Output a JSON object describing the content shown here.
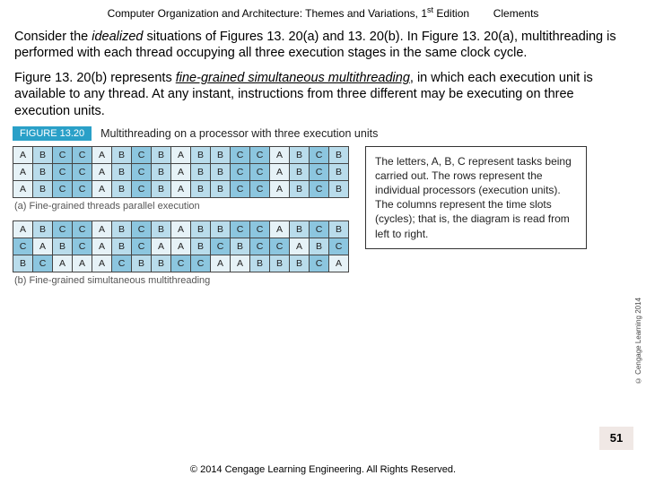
{
  "header": {
    "book": "Computer Organization and Architecture: Themes and Variations, 1",
    "edition_sup": "st",
    "edition_after": " Edition",
    "author": "Clements"
  },
  "para1_a": "Consider the ",
  "para1_b": "idealized",
  "para1_c": " situations of Figures 13. 20(a) and 13. 20(b). In Figure 13. 20(a), multithreading is performed with each thread occupying all three execution stages in the same clock cycle.",
  "para2_a": "Figure 13. 20(b) represents ",
  "para2_b": "fine-grained simultaneous multithreading",
  "para2_c": ", in which each execution unit is available to any thread. At any instant, instructions from three different may be executing on three execution units.",
  "figure": {
    "chip": "FIGURE 13.20",
    "title": "Multithreading on a processor with three execution units",
    "caption_a": "(a) Fine-grained threads parallel execution",
    "caption_b": "(b) Fine-grained simultaneous multithreading",
    "side_note": "The letters, A, B, C represent tasks being carried out. The rows represent the individual processors (execution units). The columns represent the time slots (cycles); that is, the diagram is read from left to right.",
    "table_a": [
      [
        "A",
        "B",
        "C",
        "C",
        "A",
        "B",
        "C",
        "B",
        "A",
        "B",
        "B",
        "C",
        "C",
        "A",
        "B",
        "C",
        "B"
      ],
      [
        "A",
        "B",
        "C",
        "C",
        "A",
        "B",
        "C",
        "B",
        "A",
        "B",
        "B",
        "C",
        "C",
        "A",
        "B",
        "C",
        "B"
      ],
      [
        "A",
        "B",
        "C",
        "C",
        "A",
        "B",
        "C",
        "B",
        "A",
        "B",
        "B",
        "C",
        "C",
        "A",
        "B",
        "C",
        "B"
      ]
    ],
    "table_b": [
      [
        "A",
        "B",
        "C",
        "C",
        "A",
        "B",
        "C",
        "B",
        "A",
        "B",
        "B",
        "C",
        "C",
        "A",
        "B",
        "C",
        "B"
      ],
      [
        "C",
        "A",
        "B",
        "C",
        "A",
        "B",
        "C",
        "A",
        "A",
        "B",
        "C",
        "B",
        "C",
        "C",
        "A",
        "B",
        "C"
      ],
      [
        "B",
        "C",
        "A",
        "A",
        "A",
        "C",
        "B",
        "B",
        "C",
        "C",
        "A",
        "A",
        "B",
        "B",
        "B",
        "C",
        "A"
      ]
    ]
  },
  "credit": "© Cengage Learning 2014",
  "slide_number": "51",
  "footer": "© 2014 Cengage Learning Engineering. All Rights Reserved."
}
